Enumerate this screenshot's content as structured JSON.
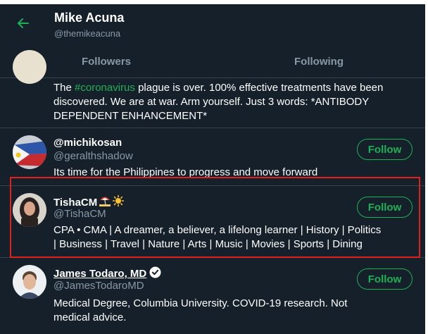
{
  "header": {
    "title": "Mike Acuna",
    "handle": "@themikeacuna"
  },
  "tabs": [
    {
      "label": "Followers"
    },
    {
      "label": "Following"
    }
  ],
  "accounts": [
    {
      "bio_prefix": "The ",
      "bio_hashtag": "#coronavirus",
      "bio_suffix": " plague is over. 100% effective treatments have been discovered. We are at war. Arm yourself. Just 3 words: *ANTIBODY DEPENDENT ENHANCEMENT*"
    },
    {
      "name": "@michikosan",
      "handle": "@geralthshadow",
      "bio": "Its time for the Philippines to progress and move forward",
      "follow_label": "Follow"
    },
    {
      "name": "TishaCM",
      "name_emojis": [
        "umbrella-on-beach-emoji",
        "sun-emoji"
      ],
      "handle": "@TishaCM",
      "bio": "CPA • CMA | A dreamer, a believer, a lifelong learner | History | Politics | Business | Travel | Nature | Arts | Music | Movies | Sports | Dining",
      "follow_label": "Follow"
    },
    {
      "name": "James Todaro, MD",
      "handle": "@JamesTodaroMD",
      "bio": "Medical Degree, Columbia University. COVID-19 research. Not medical advice.",
      "follow_label": "Follow",
      "verified": true
    }
  ],
  "colors": {
    "background": "#15202b",
    "accent": "#1db155",
    "secondary_text": "#8899a6",
    "divider": "#38444d",
    "highlight_box": "#e0201c"
  }
}
